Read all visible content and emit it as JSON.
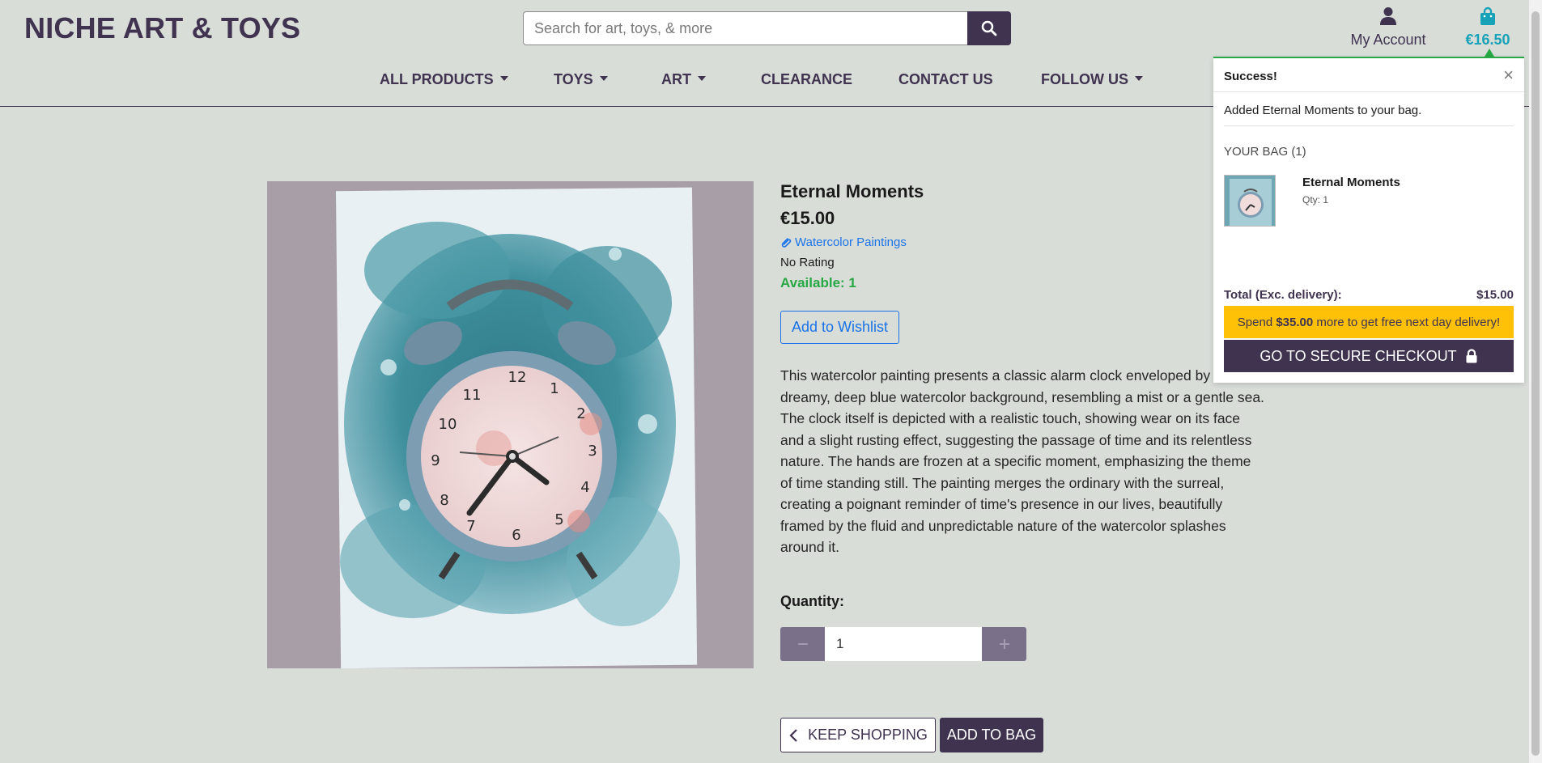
{
  "header": {
    "brand": "NICHE ART & TOYS",
    "search_placeholder": "Search for art, toys, & more",
    "account_label": "My Account",
    "bag_total": "€16.50"
  },
  "nav": [
    {
      "label": "ALL PRODUCTS",
      "dropdown": true
    },
    {
      "label": "TOYS",
      "dropdown": true
    },
    {
      "label": "ART",
      "dropdown": true
    },
    {
      "label": "CLEARANCE",
      "dropdown": false
    },
    {
      "label": "CONTACT US",
      "dropdown": false
    },
    {
      "label": "FOLLOW US",
      "dropdown": true
    }
  ],
  "product": {
    "title": "Eternal Moments",
    "price": "€15.00",
    "category": "Watercolor Paintings",
    "rating": "No Rating",
    "availability": "Available: 1",
    "wishlist_label": "Add to Wishlist",
    "description": "This watercolor painting presents a classic alarm clock enveloped by a dreamy, deep blue watercolor background, resembling a mist or a gentle sea. The clock itself is depicted with a realistic touch, showing wear on its face and a slight rusting effect, suggesting the passage of time and its relentless nature. The hands are frozen at a specific moment, emphasizing the theme of time standing still. The painting merges the ordinary with the surreal, creating a poignant reminder of time's presence in our lives, beautifully framed by the fluid and unpredictable nature of the watercolor splashes around it.",
    "quantity_label": "Quantity:",
    "quantity_value": "1",
    "keep_shopping_label": "KEEP SHOPPING",
    "add_to_bag_label": "ADD TO BAG"
  },
  "toast": {
    "title": "Success!",
    "close_glyph": "×",
    "message": "Added Eternal Moments to your bag.",
    "bag_label": "YOUR BAG (1)",
    "item_name": "Eternal Moments",
    "item_qty": "Qty: 1",
    "total_label": "Total (Exc. delivery):",
    "total_value": "$15.00",
    "promo_prefix": "Spend ",
    "promo_amount": "$35.00",
    "promo_suffix": " more to get free next day delivery!",
    "checkout_label": "GO TO SECURE CHECKOUT"
  },
  "colors": {
    "brand_purple": "#3f3350",
    "accent_teal": "#17a2b8",
    "success_green": "#28a745",
    "link_blue": "#1a73e8",
    "promo_yellow": "#ffc107",
    "page_bg": "#d9ddd8"
  },
  "icons": {
    "search": "search-icon",
    "account": "user-icon",
    "bag": "shopping-bag-icon",
    "category": "tag-icon",
    "back": "chevron-left-icon",
    "checkout": "lock-icon"
  }
}
